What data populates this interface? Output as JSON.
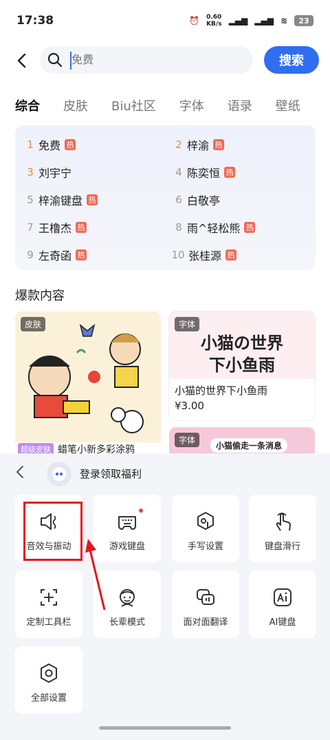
{
  "status": {
    "time": "17:38",
    "speed_value": "0.60",
    "speed_unit": "KB/s",
    "battery": "23"
  },
  "search": {
    "placeholder": "免费",
    "button_label": "搜索"
  },
  "tabs": [
    "综合",
    "皮肤",
    "Biu社区",
    "字体",
    "语录",
    "壁纸"
  ],
  "hot": [
    {
      "rank": "1",
      "name": "免费",
      "badge": "热"
    },
    {
      "rank": "2",
      "name": "梓渝",
      "badge": "热"
    },
    {
      "rank": "3",
      "name": "刘宇宁",
      "badge": ""
    },
    {
      "rank": "4",
      "name": "陈奕恒",
      "badge": "热"
    },
    {
      "rank": "5",
      "name": "梓渝键盘",
      "badge": "热"
    },
    {
      "rank": "6",
      "name": "白敬亭",
      "badge": ""
    },
    {
      "rank": "7",
      "name": "王橹杰",
      "badge": "热"
    },
    {
      "rank": "8",
      "name": "雨^轻松熊",
      "badge": "热"
    },
    {
      "rank": "9",
      "name": "左奇函",
      "badge": "热"
    },
    {
      "rank": "10",
      "name": "张桂源",
      "badge": "热"
    }
  ],
  "section_title": "爆款内容",
  "cards": {
    "left": {
      "tag": "皮肤",
      "super_tag": "超级皮肤",
      "name": "蜡笔小新多彩涂鸦"
    },
    "right": {
      "tag": "字体",
      "art_title": "小猫の世界\n下小鱼雨",
      "name": "小猫的世界下小鱼雨",
      "price": "¥3.00"
    },
    "right2": {
      "tag": "字体",
      "art_text": "小猫偷走一条消息"
    }
  },
  "sheet": {
    "login_text": "登录领取福利",
    "tiles": [
      {
        "label": "音效与振动",
        "icon": "speaker-vibrate-icon"
      },
      {
        "label": "游戏键盘",
        "icon": "gamepad-keyboard-icon"
      },
      {
        "label": "手写设置",
        "icon": "handwriting-icon"
      },
      {
        "label": "键盘滑行",
        "icon": "swipe-finger-icon"
      },
      {
        "label": "定制工具栏",
        "icon": "custom-toolbar-icon"
      },
      {
        "label": "长辈模式",
        "icon": "elder-mode-icon"
      },
      {
        "label": "面对面翻译",
        "icon": "face-translate-icon"
      },
      {
        "label": "AI键盘",
        "icon": "ai-keyboard-icon"
      },
      {
        "label": "全部设置",
        "icon": "settings-hex-icon"
      }
    ]
  },
  "colors": {
    "accent": "#2f6ef0",
    "hot_badge": "#f06a56",
    "rank_top": "#f08a2c",
    "highlight": "#e5141c"
  }
}
